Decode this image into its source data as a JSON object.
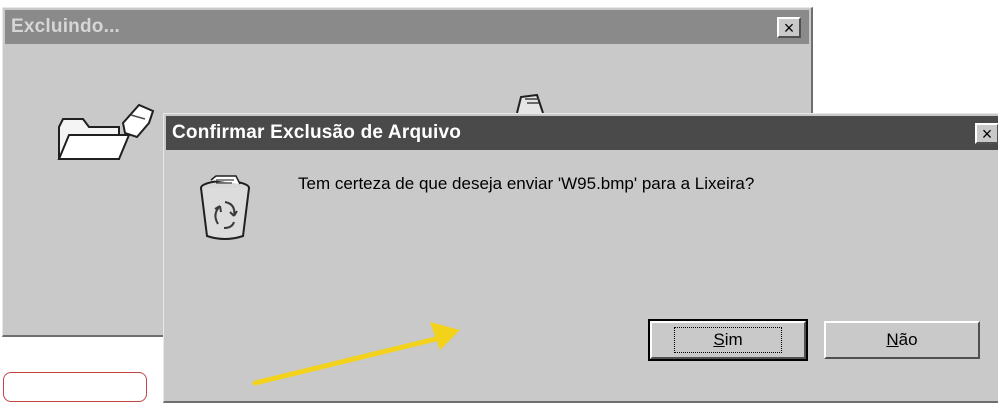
{
  "background_window": {
    "title": "Excluindo...",
    "close_label": "×"
  },
  "dialog": {
    "title": "Confirmar Exclusão de Arquivo",
    "close_label": "×",
    "message": "Tem certeza de que deseja enviar 'W95.bmp' para a Lixeira?",
    "icon": "recycle-bin-icon",
    "buttons": {
      "yes": {
        "accel": "S",
        "rest": "im"
      },
      "no": {
        "accel": "N",
        "rest": "ão"
      }
    }
  },
  "annotation": {
    "arrow_color": "#f2d21a",
    "callout_border_color": "#c24545"
  }
}
